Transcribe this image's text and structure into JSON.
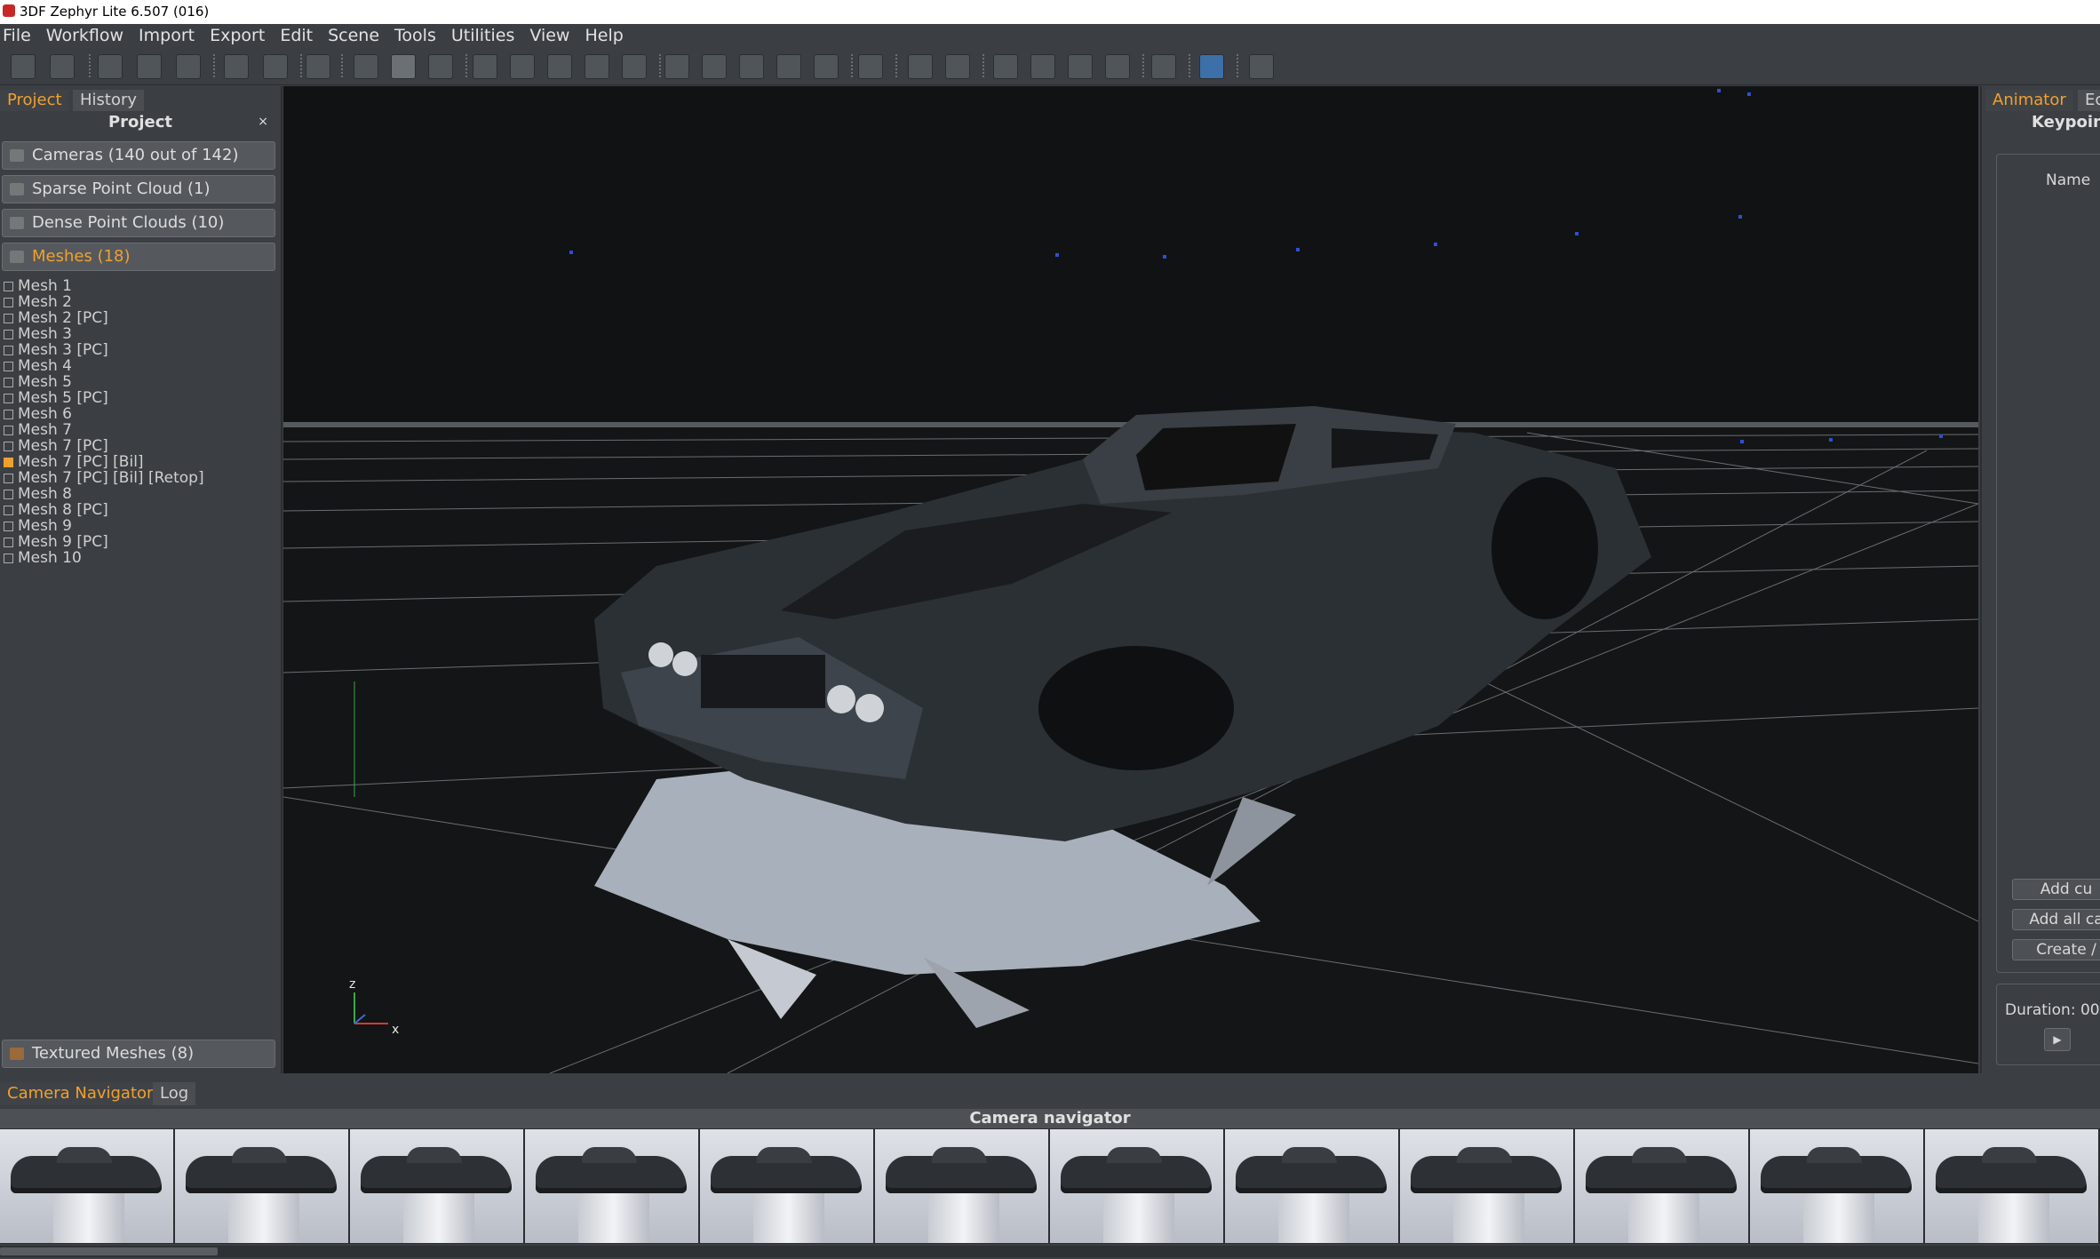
{
  "window": {
    "title": "3DF Zephyr Lite 6.507 (016)"
  },
  "menu": [
    "File",
    "Workflow",
    "Import",
    "Export",
    "Edit",
    "Scene",
    "Tools",
    "Utilities",
    "View",
    "Help"
  ],
  "toolbar": {
    "icons": [
      "new-project-icon",
      "save-icon",
      "select-region-icon",
      "cube-outline-icon",
      "cube-shaded-icon",
      "mesh-red-icon",
      "mesh-texture-icon",
      "camera-icon",
      "orbit-icon",
      "orbit-active-icon",
      "wasd-icon",
      "light-bulb-icon",
      "point-cloud-icon",
      "mesh-color-icon",
      "mesh-wire-icon",
      "brush-icon",
      "selection-tool-icon",
      "points-scatter-icon",
      "dense-points-icon",
      "box-icon",
      "color-box-icon",
      "frame-icon",
      "undo-icon",
      "redo-icon",
      "lasso-icon",
      "rotate-icon",
      "gizmo-icon",
      "measure-icon",
      "tool-icon",
      "logo-cube-icon",
      "help-icon"
    ]
  },
  "left_panel": {
    "tabs": [
      "Project",
      "History"
    ],
    "header": "Project",
    "close": "×",
    "groups": [
      {
        "label": "Cameras (140 out of 142)"
      },
      {
        "label": "Sparse Point Cloud (1)"
      },
      {
        "label": "Dense Point Clouds (10)"
      },
      {
        "label": "Meshes (18)"
      }
    ],
    "meshes": [
      {
        "label": "Mesh 1",
        "checked": false
      },
      {
        "label": "Mesh 2",
        "checked": false
      },
      {
        "label": "Mesh 2 [PC]",
        "checked": false
      },
      {
        "label": "Mesh 3",
        "checked": false
      },
      {
        "label": "Mesh 3 [PC]",
        "checked": false
      },
      {
        "label": "Mesh 4",
        "checked": false
      },
      {
        "label": "Mesh 5",
        "checked": false
      },
      {
        "label": "Mesh 5 [PC]",
        "checked": false
      },
      {
        "label": "Mesh 6",
        "checked": false
      },
      {
        "label": "Mesh 7",
        "checked": false
      },
      {
        "label": "Mesh 7 [PC]",
        "checked": false
      },
      {
        "label": "Mesh 7 [PC] [Bil]",
        "checked": true
      },
      {
        "label": "Mesh 7 [PC] [Bil] [Retop]",
        "checked": false
      },
      {
        "label": "Mesh 8",
        "checked": false
      },
      {
        "label": "Mesh 8 [PC]",
        "checked": false
      },
      {
        "label": "Mesh 9",
        "checked": false
      },
      {
        "label": "Mesh 9 [PC]",
        "checked": false
      },
      {
        "label": "Mesh 10",
        "checked": false
      }
    ],
    "textured": "Textured Meshes (8)"
  },
  "viewport": {
    "axis_z": "z",
    "axis_x": "x"
  },
  "right_panel": {
    "tabs": [
      "Animator",
      "Ec"
    ],
    "header": "Keypoint",
    "name_label": "Name",
    "buttons": [
      "Add cu",
      "Add all ca",
      "Create /"
    ],
    "duration_label": "Duration:",
    "duration_value": "00"
  },
  "bottom_panel": {
    "tabs": [
      "Camera Navigator",
      "Log"
    ],
    "header": "Camera navigator"
  },
  "colors": {
    "accent": "#f0a030",
    "panel": "#3b3f43",
    "viewport": "#111213"
  }
}
